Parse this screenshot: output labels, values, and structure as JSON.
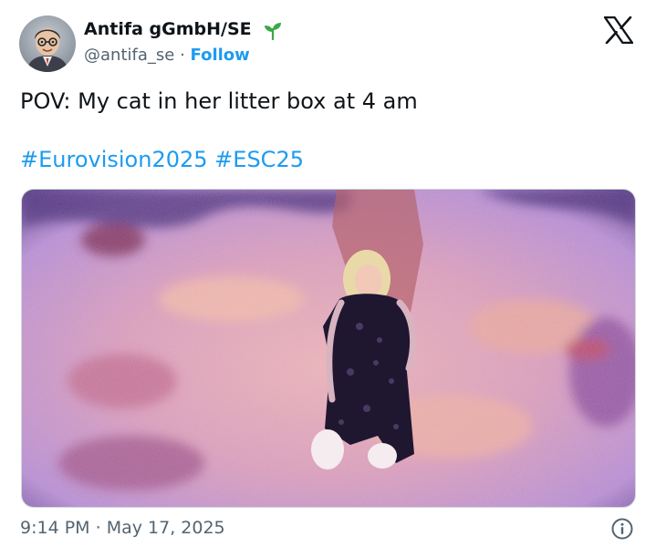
{
  "author": {
    "display_name": "Antifa gGmbH/SE",
    "handle": "@antifa_se",
    "separator": "·",
    "follow_label": "Follow",
    "badge_icon": "sprout-icon",
    "avatar_icon": "avatar-icon"
  },
  "platform_icon": "x-logo-icon",
  "tweet": {
    "text": "POV: My cat in her litter box at 4 am",
    "hashtags": [
      "#Eurovision2025",
      "#ESC25"
    ]
  },
  "media": {
    "type": "photo"
  },
  "meta": {
    "time": "9:14 PM",
    "separator": "·",
    "date": "May 17, 2025",
    "info_icon": "info-icon"
  },
  "colors": {
    "link": "#1d9bf0",
    "text": "#0f1419",
    "secondary": "#536471",
    "badge_green": "#3aa845"
  }
}
